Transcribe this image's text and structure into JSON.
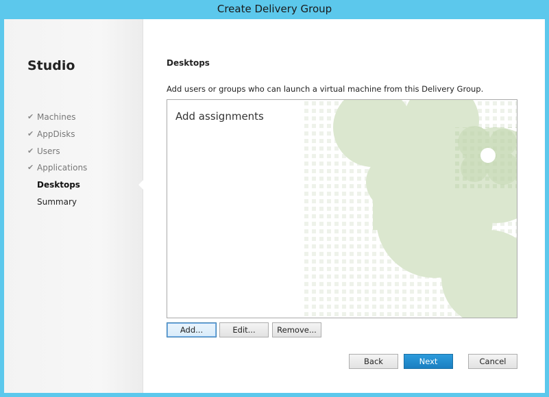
{
  "window": {
    "title": "Create Delivery Group"
  },
  "sidebar": {
    "brand": "Studio",
    "steps": [
      {
        "label": "Machines",
        "state": "done"
      },
      {
        "label": "AppDisks",
        "state": "done"
      },
      {
        "label": "Users",
        "state": "done"
      },
      {
        "label": "Applications",
        "state": "done"
      },
      {
        "label": "Desktops",
        "state": "active"
      },
      {
        "label": "Summary",
        "state": "pending"
      }
    ],
    "check_glyph": "✔"
  },
  "content": {
    "title": "Desktops",
    "instructions": "Add users or groups who can launch a virtual machine from this Delivery Group.",
    "assignments_heading": "Add assignments",
    "buttons": {
      "add": "Add...",
      "edit": "Edit...",
      "remove": "Remove..."
    }
  },
  "footer": {
    "back": "Back",
    "next": "Next",
    "cancel": "Cancel"
  },
  "colors": {
    "titlebar": "#5cc8ec",
    "primary_button": "#1b7fc1",
    "art_green": "#d4e2c6"
  }
}
